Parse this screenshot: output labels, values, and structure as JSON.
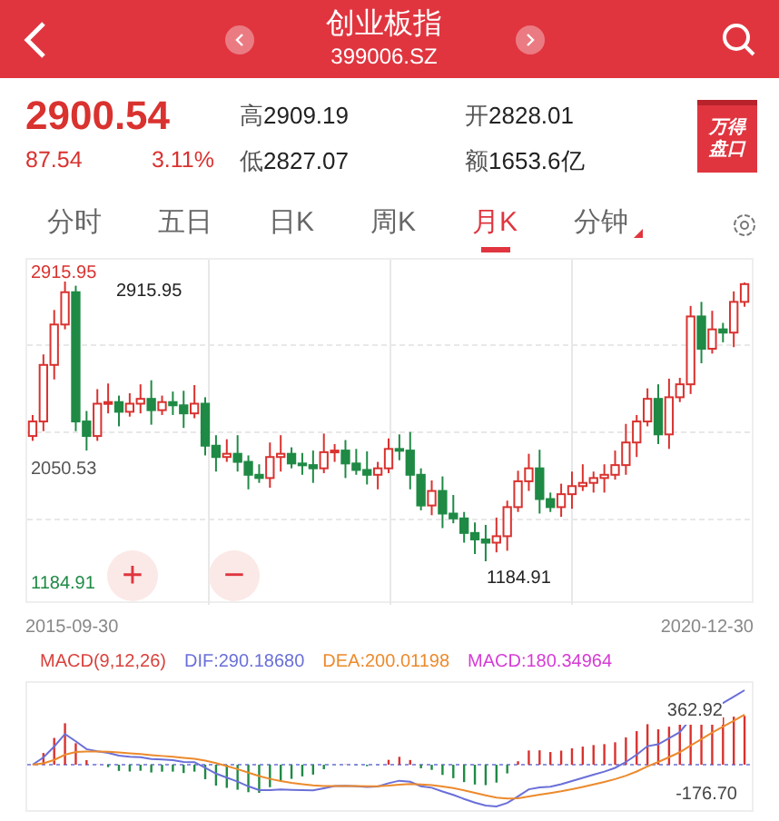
{
  "header": {
    "title": "创业板指",
    "code": "399006.SZ"
  },
  "quote": {
    "price": "2900.54",
    "change": "87.54",
    "percent": "3.11%",
    "stats": [
      {
        "label": "高",
        "value": "2909.19"
      },
      {
        "label": "开",
        "value": "2828.01"
      },
      {
        "label": "低",
        "value": "2827.07"
      },
      {
        "label": "额",
        "value": "1653.6亿"
      }
    ],
    "badge": [
      "万得",
      "盘口"
    ]
  },
  "tabs": [
    {
      "label": "分时",
      "selected": false
    },
    {
      "label": "五日",
      "selected": false
    },
    {
      "label": "日K",
      "selected": false
    },
    {
      "label": "周K",
      "selected": false
    },
    {
      "label": "月K",
      "selected": true
    },
    {
      "label": "分钟",
      "selected": false,
      "dropdown": true
    }
  ],
  "kline": {
    "chart_data": {
      "type": "candlestick",
      "ohlc": [
        [
          1960,
          2090,
          1930,
          2050
        ],
        [
          2050,
          2465,
          1990,
          2400
        ],
        [
          2400,
          2740,
          2310,
          2650
        ],
        [
          2650,
          2915.95,
          2620,
          2850
        ],
        [
          2850,
          2890,
          1990,
          2050
        ],
        [
          2050,
          2115,
          1870,
          1960
        ],
        [
          1960,
          2250,
          1930,
          2160
        ],
        [
          2160,
          2285,
          2100,
          2170
        ],
        [
          2170,
          2210,
          2020,
          2110
        ],
        [
          2110,
          2225,
          2080,
          2160
        ],
        [
          2160,
          2280,
          2100,
          2190
        ],
        [
          2190,
          2305,
          2030,
          2120
        ],
        [
          2120,
          2210,
          2090,
          2170
        ],
        [
          2170,
          2235,
          2090,
          2150
        ],
        [
          2150,
          2240,
          2010,
          2100
        ],
        [
          2100,
          2275,
          2070,
          2160
        ],
        [
          2160,
          2200,
          1840,
          1900
        ],
        [
          1900,
          1965,
          1740,
          1830
        ],
        [
          1830,
          1940,
          1800,
          1850
        ],
        [
          1850,
          1965,
          1740,
          1800
        ],
        [
          1800,
          1840,
          1630,
          1720
        ],
        [
          1720,
          1785,
          1670,
          1700
        ],
        [
          1700,
          1920,
          1640,
          1830
        ],
        [
          1830,
          1965,
          1740,
          1850
        ],
        [
          1850,
          1890,
          1760,
          1790
        ],
        [
          1790,
          1855,
          1720,
          1780
        ],
        [
          1780,
          1870,
          1670,
          1760
        ],
        [
          1760,
          1975,
          1730,
          1860
        ],
        [
          1860,
          1910,
          1800,
          1870
        ],
        [
          1870,
          1935,
          1700,
          1790
        ],
        [
          1790,
          1880,
          1720,
          1750
        ],
        [
          1750,
          1865,
          1660,
          1720
        ],
        [
          1720,
          1800,
          1630,
          1760
        ],
        [
          1760,
          1945,
          1730,
          1880
        ],
        [
          1880,
          1970,
          1810,
          1870
        ],
        [
          1870,
          1985,
          1630,
          1720
        ],
        [
          1720,
          1760,
          1500,
          1530
        ],
        [
          1530,
          1685,
          1470,
          1620
        ],
        [
          1620,
          1710,
          1390,
          1480
        ],
        [
          1480,
          1595,
          1420,
          1450
        ],
        [
          1450,
          1490,
          1300,
          1360
        ],
        [
          1360,
          1425,
          1230,
          1320
        ],
        [
          1320,
          1410,
          1184.91,
          1300
        ],
        [
          1300,
          1455,
          1240,
          1340
        ],
        [
          1340,
          1560,
          1250,
          1520
        ],
        [
          1520,
          1745,
          1490,
          1680
        ],
        [
          1680,
          1850,
          1620,
          1760
        ],
        [
          1760,
          1875,
          1480,
          1570
        ],
        [
          1570,
          1610,
          1490,
          1520
        ],
        [
          1520,
          1665,
          1460,
          1600
        ],
        [
          1600,
          1740,
          1510,
          1650
        ],
        [
          1650,
          1785,
          1620,
          1670
        ],
        [
          1670,
          1740,
          1610,
          1700
        ],
        [
          1700,
          1785,
          1610,
          1720
        ],
        [
          1720,
          1870,
          1690,
          1780
        ],
        [
          1780,
          2035,
          1720,
          1920
        ],
        [
          1920,
          2090,
          1830,
          2050
        ],
        [
          2050,
          2255,
          2020,
          2190
        ],
        [
          2190,
          2280,
          1910,
          1970
        ],
        [
          1970,
          2315,
          1880,
          2200
        ],
        [
          2200,
          2320,
          2170,
          2280
        ],
        [
          2280,
          2765,
          2220,
          2700
        ],
        [
          2700,
          2790,
          2410,
          2500
        ],
        [
          2500,
          2735,
          2470,
          2620
        ],
        [
          2620,
          2660,
          2540,
          2600
        ],
        [
          2600,
          2855,
          2510,
          2790
        ],
        [
          2790,
          2910,
          2760,
          2900
        ]
      ]
    },
    "axis_high": "2915.95",
    "high_marker": "2915.95",
    "axis_mid": "2050.53",
    "axis_low": "1184.91",
    "low_marker": "1184.91",
    "zoom_in": "+",
    "zoom_out": "−"
  },
  "dates": {
    "start": "2015-09-30",
    "end": "2020-12-30"
  },
  "macd": {
    "legend": [
      {
        "text": "MACD(9,12,26)",
        "color": "#d9413c"
      },
      {
        "text": "DIF:290.18680",
        "color": "#6a6fd8"
      },
      {
        "text": "DEA:200.01198",
        "color": "#ec8a2c"
      },
      {
        "text": "MACD:180.34964",
        "color": "#d63bd6"
      }
    ],
    "top_value": "362.92",
    "bottom_value": "-176.70"
  }
}
